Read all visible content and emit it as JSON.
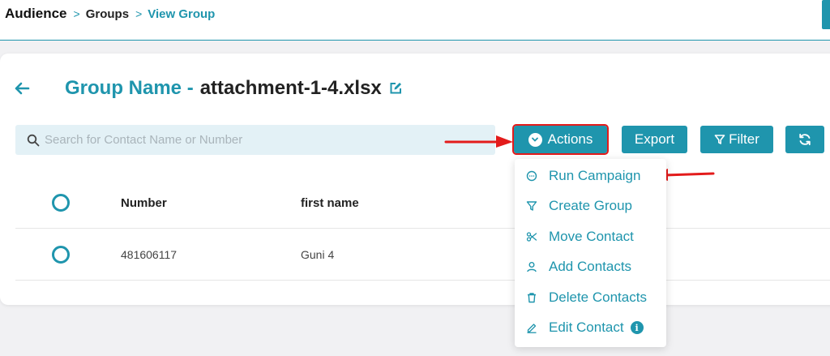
{
  "breadcrumb": {
    "root": "Audience",
    "separator": ">",
    "groups": "Groups",
    "current": "View Group"
  },
  "page": {
    "title_prefix": "Group Name -",
    "group_name": "attachment-1-4.xlsx"
  },
  "search": {
    "placeholder": "Search for Contact Name or Number",
    "value": ""
  },
  "toolbar": {
    "actions_label": "Actions",
    "export_label": "Export",
    "filter_label": "Filter"
  },
  "table": {
    "columns": [
      "Number",
      "first name"
    ],
    "rows": [
      {
        "number": "481606117",
        "first_name": "Guni 4"
      }
    ]
  },
  "actions_menu": {
    "items": [
      {
        "label": "Run Campaign",
        "icon": "chat-bubble-icon"
      },
      {
        "label": "Create Group",
        "icon": "funnel-icon"
      },
      {
        "label": "Move Contact",
        "icon": "scissors-icon"
      },
      {
        "label": "Add Contacts",
        "icon": "user-icon"
      },
      {
        "label": "Delete Contacts",
        "icon": "trash-icon"
      },
      {
        "label": "Edit Contact",
        "icon": "pencil-icon"
      }
    ],
    "info_badge": "i"
  },
  "colors": {
    "accent": "#1f95ad",
    "annotation_arrow": "#e31b1b",
    "search_bg": "#e3f1f6",
    "page_bg": "#f1f1f3"
  }
}
